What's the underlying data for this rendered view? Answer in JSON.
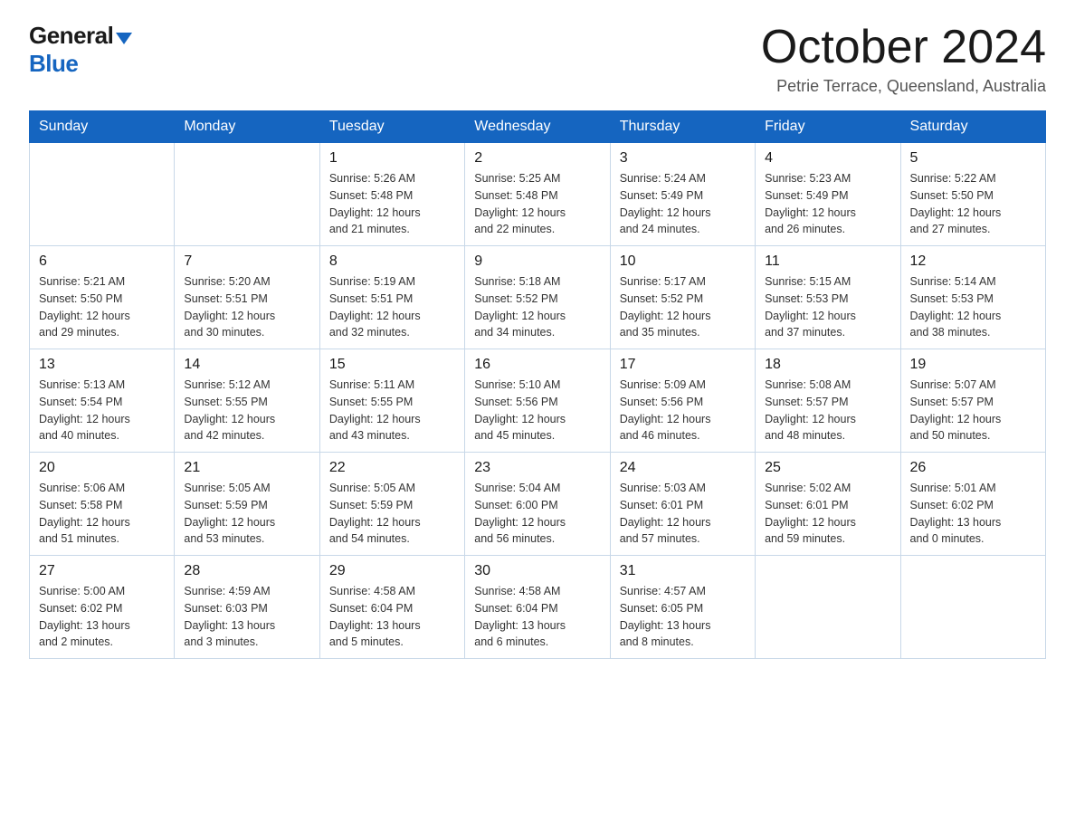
{
  "logo": {
    "general": "General",
    "blue": "Blue"
  },
  "header": {
    "month": "October 2024",
    "location": "Petrie Terrace, Queensland, Australia"
  },
  "weekdays": [
    "Sunday",
    "Monday",
    "Tuesday",
    "Wednesday",
    "Thursday",
    "Friday",
    "Saturday"
  ],
  "weeks": [
    [
      {
        "day": "",
        "info": ""
      },
      {
        "day": "",
        "info": ""
      },
      {
        "day": "1",
        "info": "Sunrise: 5:26 AM\nSunset: 5:48 PM\nDaylight: 12 hours\nand 21 minutes."
      },
      {
        "day": "2",
        "info": "Sunrise: 5:25 AM\nSunset: 5:48 PM\nDaylight: 12 hours\nand 22 minutes."
      },
      {
        "day": "3",
        "info": "Sunrise: 5:24 AM\nSunset: 5:49 PM\nDaylight: 12 hours\nand 24 minutes."
      },
      {
        "day": "4",
        "info": "Sunrise: 5:23 AM\nSunset: 5:49 PM\nDaylight: 12 hours\nand 26 minutes."
      },
      {
        "day": "5",
        "info": "Sunrise: 5:22 AM\nSunset: 5:50 PM\nDaylight: 12 hours\nand 27 minutes."
      }
    ],
    [
      {
        "day": "6",
        "info": "Sunrise: 5:21 AM\nSunset: 5:50 PM\nDaylight: 12 hours\nand 29 minutes."
      },
      {
        "day": "7",
        "info": "Sunrise: 5:20 AM\nSunset: 5:51 PM\nDaylight: 12 hours\nand 30 minutes."
      },
      {
        "day": "8",
        "info": "Sunrise: 5:19 AM\nSunset: 5:51 PM\nDaylight: 12 hours\nand 32 minutes."
      },
      {
        "day": "9",
        "info": "Sunrise: 5:18 AM\nSunset: 5:52 PM\nDaylight: 12 hours\nand 34 minutes."
      },
      {
        "day": "10",
        "info": "Sunrise: 5:17 AM\nSunset: 5:52 PM\nDaylight: 12 hours\nand 35 minutes."
      },
      {
        "day": "11",
        "info": "Sunrise: 5:15 AM\nSunset: 5:53 PM\nDaylight: 12 hours\nand 37 minutes."
      },
      {
        "day": "12",
        "info": "Sunrise: 5:14 AM\nSunset: 5:53 PM\nDaylight: 12 hours\nand 38 minutes."
      }
    ],
    [
      {
        "day": "13",
        "info": "Sunrise: 5:13 AM\nSunset: 5:54 PM\nDaylight: 12 hours\nand 40 minutes."
      },
      {
        "day": "14",
        "info": "Sunrise: 5:12 AM\nSunset: 5:55 PM\nDaylight: 12 hours\nand 42 minutes."
      },
      {
        "day": "15",
        "info": "Sunrise: 5:11 AM\nSunset: 5:55 PM\nDaylight: 12 hours\nand 43 minutes."
      },
      {
        "day": "16",
        "info": "Sunrise: 5:10 AM\nSunset: 5:56 PM\nDaylight: 12 hours\nand 45 minutes."
      },
      {
        "day": "17",
        "info": "Sunrise: 5:09 AM\nSunset: 5:56 PM\nDaylight: 12 hours\nand 46 minutes."
      },
      {
        "day": "18",
        "info": "Sunrise: 5:08 AM\nSunset: 5:57 PM\nDaylight: 12 hours\nand 48 minutes."
      },
      {
        "day": "19",
        "info": "Sunrise: 5:07 AM\nSunset: 5:57 PM\nDaylight: 12 hours\nand 50 minutes."
      }
    ],
    [
      {
        "day": "20",
        "info": "Sunrise: 5:06 AM\nSunset: 5:58 PM\nDaylight: 12 hours\nand 51 minutes."
      },
      {
        "day": "21",
        "info": "Sunrise: 5:05 AM\nSunset: 5:59 PM\nDaylight: 12 hours\nand 53 minutes."
      },
      {
        "day": "22",
        "info": "Sunrise: 5:05 AM\nSunset: 5:59 PM\nDaylight: 12 hours\nand 54 minutes."
      },
      {
        "day": "23",
        "info": "Sunrise: 5:04 AM\nSunset: 6:00 PM\nDaylight: 12 hours\nand 56 minutes."
      },
      {
        "day": "24",
        "info": "Sunrise: 5:03 AM\nSunset: 6:01 PM\nDaylight: 12 hours\nand 57 minutes."
      },
      {
        "day": "25",
        "info": "Sunrise: 5:02 AM\nSunset: 6:01 PM\nDaylight: 12 hours\nand 59 minutes."
      },
      {
        "day": "26",
        "info": "Sunrise: 5:01 AM\nSunset: 6:02 PM\nDaylight: 13 hours\nand 0 minutes."
      }
    ],
    [
      {
        "day": "27",
        "info": "Sunrise: 5:00 AM\nSunset: 6:02 PM\nDaylight: 13 hours\nand 2 minutes."
      },
      {
        "day": "28",
        "info": "Sunrise: 4:59 AM\nSunset: 6:03 PM\nDaylight: 13 hours\nand 3 minutes."
      },
      {
        "day": "29",
        "info": "Sunrise: 4:58 AM\nSunset: 6:04 PM\nDaylight: 13 hours\nand 5 minutes."
      },
      {
        "day": "30",
        "info": "Sunrise: 4:58 AM\nSunset: 6:04 PM\nDaylight: 13 hours\nand 6 minutes."
      },
      {
        "day": "31",
        "info": "Sunrise: 4:57 AM\nSunset: 6:05 PM\nDaylight: 13 hours\nand 8 minutes."
      },
      {
        "day": "",
        "info": ""
      },
      {
        "day": "",
        "info": ""
      }
    ]
  ]
}
